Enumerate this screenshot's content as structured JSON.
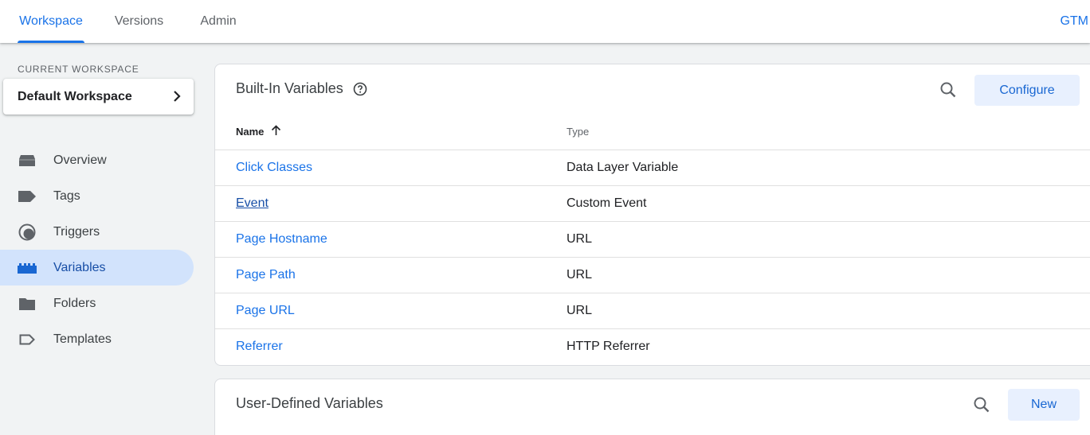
{
  "header": {
    "tabs": [
      {
        "label": "Workspace",
        "active": true
      },
      {
        "label": "Versions",
        "active": false
      },
      {
        "label": "Admin",
        "active": false
      }
    ],
    "brand": "GTM"
  },
  "sidebar": {
    "workspace_label": "CURRENT WORKSPACE",
    "workspace_name": "Default Workspace",
    "items": [
      {
        "label": "Overview",
        "icon": "overview-icon"
      },
      {
        "label": "Tags",
        "icon": "tag-icon"
      },
      {
        "label": "Triggers",
        "icon": "trigger-icon"
      },
      {
        "label": "Variables",
        "icon": "variables-icon",
        "active": true
      },
      {
        "label": "Folders",
        "icon": "folder-icon"
      },
      {
        "label": "Templates",
        "icon": "template-icon"
      }
    ]
  },
  "builtin": {
    "title": "Built-In Variables",
    "configure_label": "Configure",
    "columns": {
      "name": "Name",
      "type": "Type"
    },
    "rows": [
      {
        "name": "Click Classes",
        "type": "Data Layer Variable"
      },
      {
        "name": "Event",
        "type": "Custom Event"
      },
      {
        "name": "Page Hostname",
        "type": "URL"
      },
      {
        "name": "Page Path",
        "type": "URL"
      },
      {
        "name": "Page URL",
        "type": "URL"
      },
      {
        "name": "Referrer",
        "type": "HTTP Referrer"
      }
    ]
  },
  "userdefined": {
    "title": "User-Defined Variables",
    "new_label": "New"
  },
  "colors": {
    "accent": "#1a73e8",
    "active_nav_bg": "#d2e3fc",
    "button_bg": "#e8f0fe"
  }
}
